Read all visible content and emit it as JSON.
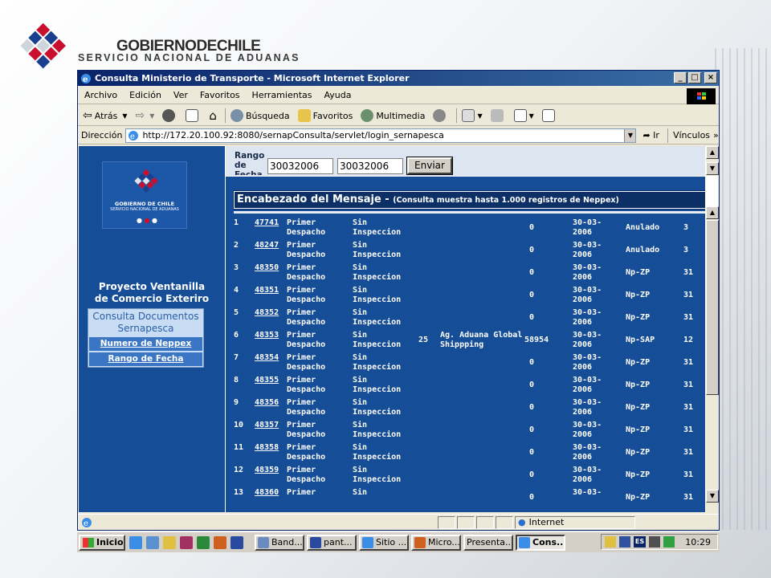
{
  "header": {
    "gobierno": "GOBIERNODECHILE",
    "servicio": "SERVICIO NACIONAL DE ADUANAS"
  },
  "window": {
    "title": "Consulta Ministerio de Transporte - Microsoft Internet Explorer",
    "menu": [
      "Archivo",
      "Edición",
      "Ver",
      "Favoritos",
      "Herramientas",
      "Ayuda"
    ],
    "toolbar": {
      "back": "Atrás",
      "search": "Búsqueda",
      "favorites": "Favoritos",
      "multimedia": "Multimedia"
    },
    "address_label": "Dirección",
    "address": "http://172.20.100.92:8080/sernapConsulta/servlet/login_sernapesca",
    "go": "Ir",
    "links": "Vínculos",
    "status": "Internet"
  },
  "left": {
    "logo_line1": "GOBIERNO DE CHILE",
    "logo_line2": "SERVICIO NACIONAL DE ADUANAS",
    "project_line1": "Proyecto Ventanilla",
    "project_line2": "de Comercio Exteriro",
    "consulta_line1": "Consulta Documentos",
    "consulta_line2": "Sernapesca",
    "link1": "Numero de Neppex",
    "link2": "Rango de Fecha"
  },
  "form": {
    "rango_label": "Rango de Fecha",
    "from": "30032006",
    "to": "30032006",
    "submit": "Enviar"
  },
  "results": {
    "heading": "Encabezado del Mensaje - ",
    "heading_note": "(Consulta muestra hasta 1.000 registros de Neppex)",
    "rows": [
      {
        "n": "1",
        "id": "47741",
        "tipo1": "Primer",
        "tipo2": "Despacho",
        "ins1": "Sin",
        "ins2": "Inspeccion",
        "cod": "",
        "agente1": "",
        "agente2": "",
        "num": "",
        "qty": "0",
        "fecha1": "30-03-",
        "fecha2": "2006",
        "estado": "Anulado",
        "x": "3"
      },
      {
        "n": "2",
        "id": "48247",
        "tipo1": "Primer",
        "tipo2": "Despacho",
        "ins1": "Sin",
        "ins2": "Inspeccion",
        "cod": "",
        "agente1": "",
        "agente2": "",
        "num": "",
        "qty": "0",
        "fecha1": "30-03-",
        "fecha2": "2006",
        "estado": "Anulado",
        "x": "3"
      },
      {
        "n": "3",
        "id": "48350",
        "tipo1": "Primer",
        "tipo2": "Despacho",
        "ins1": "Sin",
        "ins2": "Inspeccion",
        "cod": "",
        "agente1": "",
        "agente2": "",
        "num": "",
        "qty": "0",
        "fecha1": "30-03-",
        "fecha2": "2006",
        "estado": "Np-ZP",
        "x": "31"
      },
      {
        "n": "4",
        "id": "48351",
        "tipo1": "Primer",
        "tipo2": "Despacho",
        "ins1": "Sin",
        "ins2": "Inspeccion",
        "cod": "",
        "agente1": "",
        "agente2": "",
        "num": "",
        "qty": "0",
        "fecha1": "30-03-",
        "fecha2": "2006",
        "estado": "Np-ZP",
        "x": "31"
      },
      {
        "n": "5",
        "id": "48352",
        "tipo1": "Primer",
        "tipo2": "Despacho",
        "ins1": "Sin",
        "ins2": "Inspeccion",
        "cod": "",
        "agente1": "",
        "agente2": "",
        "num": "",
        "qty": "0",
        "fecha1": "30-03-",
        "fecha2": "2006",
        "estado": "Np-ZP",
        "x": "31"
      },
      {
        "n": "6",
        "id": "48353",
        "tipo1": "Primer",
        "tipo2": "Despacho",
        "ins1": "Sin",
        "ins2": "Inspeccion",
        "cod": "25",
        "agente1": "Ag. Aduana Global",
        "agente2": "Shippping",
        "num": "58954",
        "qty": "",
        "fecha1": "30-03-",
        "fecha2": "2006",
        "estado": "Np-SAP",
        "x": "12"
      },
      {
        "n": "7",
        "id": "48354",
        "tipo1": "Primer",
        "tipo2": "Despacho",
        "ins1": "Sin",
        "ins2": "Inspeccion",
        "cod": "",
        "agente1": "",
        "agente2": "",
        "num": "",
        "qty": "0",
        "fecha1": "30-03-",
        "fecha2": "2006",
        "estado": "Np-ZP",
        "x": "31"
      },
      {
        "n": "8",
        "id": "48355",
        "tipo1": "Primer",
        "tipo2": "Despacho",
        "ins1": "Sin",
        "ins2": "Inspeccion",
        "cod": "",
        "agente1": "",
        "agente2": "",
        "num": "",
        "qty": "0",
        "fecha1": "30-03-",
        "fecha2": "2006",
        "estado": "Np-ZP",
        "x": "31"
      },
      {
        "n": "9",
        "id": "48356",
        "tipo1": "Primer",
        "tipo2": "Despacho",
        "ins1": "Sin",
        "ins2": "Inspeccion",
        "cod": "",
        "agente1": "",
        "agente2": "",
        "num": "",
        "qty": "0",
        "fecha1": "30-03-",
        "fecha2": "2006",
        "estado": "Np-ZP",
        "x": "31"
      },
      {
        "n": "10",
        "id": "48357",
        "tipo1": "Primer",
        "tipo2": "Despacho",
        "ins1": "Sin",
        "ins2": "Inspeccion",
        "cod": "",
        "agente1": "",
        "agente2": "",
        "num": "",
        "qty": "0",
        "fecha1": "30-03-",
        "fecha2": "2006",
        "estado": "Np-ZP",
        "x": "31"
      },
      {
        "n": "11",
        "id": "48358",
        "tipo1": "Primer",
        "tipo2": "Despacho",
        "ins1": "Sin",
        "ins2": "Inspeccion",
        "cod": "",
        "agente1": "",
        "agente2": "",
        "num": "",
        "qty": "0",
        "fecha1": "30-03-",
        "fecha2": "2006",
        "estado": "Np-ZP",
        "x": "31"
      },
      {
        "n": "12",
        "id": "48359",
        "tipo1": "Primer",
        "tipo2": "Despacho",
        "ins1": "Sin",
        "ins2": "Inspeccion",
        "cod": "",
        "agente1": "",
        "agente2": "",
        "num": "",
        "qty": "0",
        "fecha1": "30-03-",
        "fecha2": "2006",
        "estado": "Np-ZP",
        "x": "31"
      },
      {
        "n": "13",
        "id": "48360",
        "tipo1": "Primer",
        "tipo2": "",
        "ins1": "Sin",
        "ins2": "",
        "cod": "",
        "agente1": "",
        "agente2": "",
        "num": "",
        "qty": "0",
        "fecha1": "30-03-",
        "fecha2": "",
        "estado": "Np-ZP",
        "x": "31"
      }
    ]
  },
  "taskbar": {
    "start": "Inicio",
    "tasks": [
      "Band...",
      "pant...",
      "Sitio ...",
      "Micro...",
      "Presenta...",
      "Cons..."
    ],
    "tray_lang": "ES",
    "clock": "10:29"
  },
  "colors": {
    "frame_blue": "#154d96",
    "title_blue": "#0a246a",
    "link_blue": "#3a76c4"
  }
}
